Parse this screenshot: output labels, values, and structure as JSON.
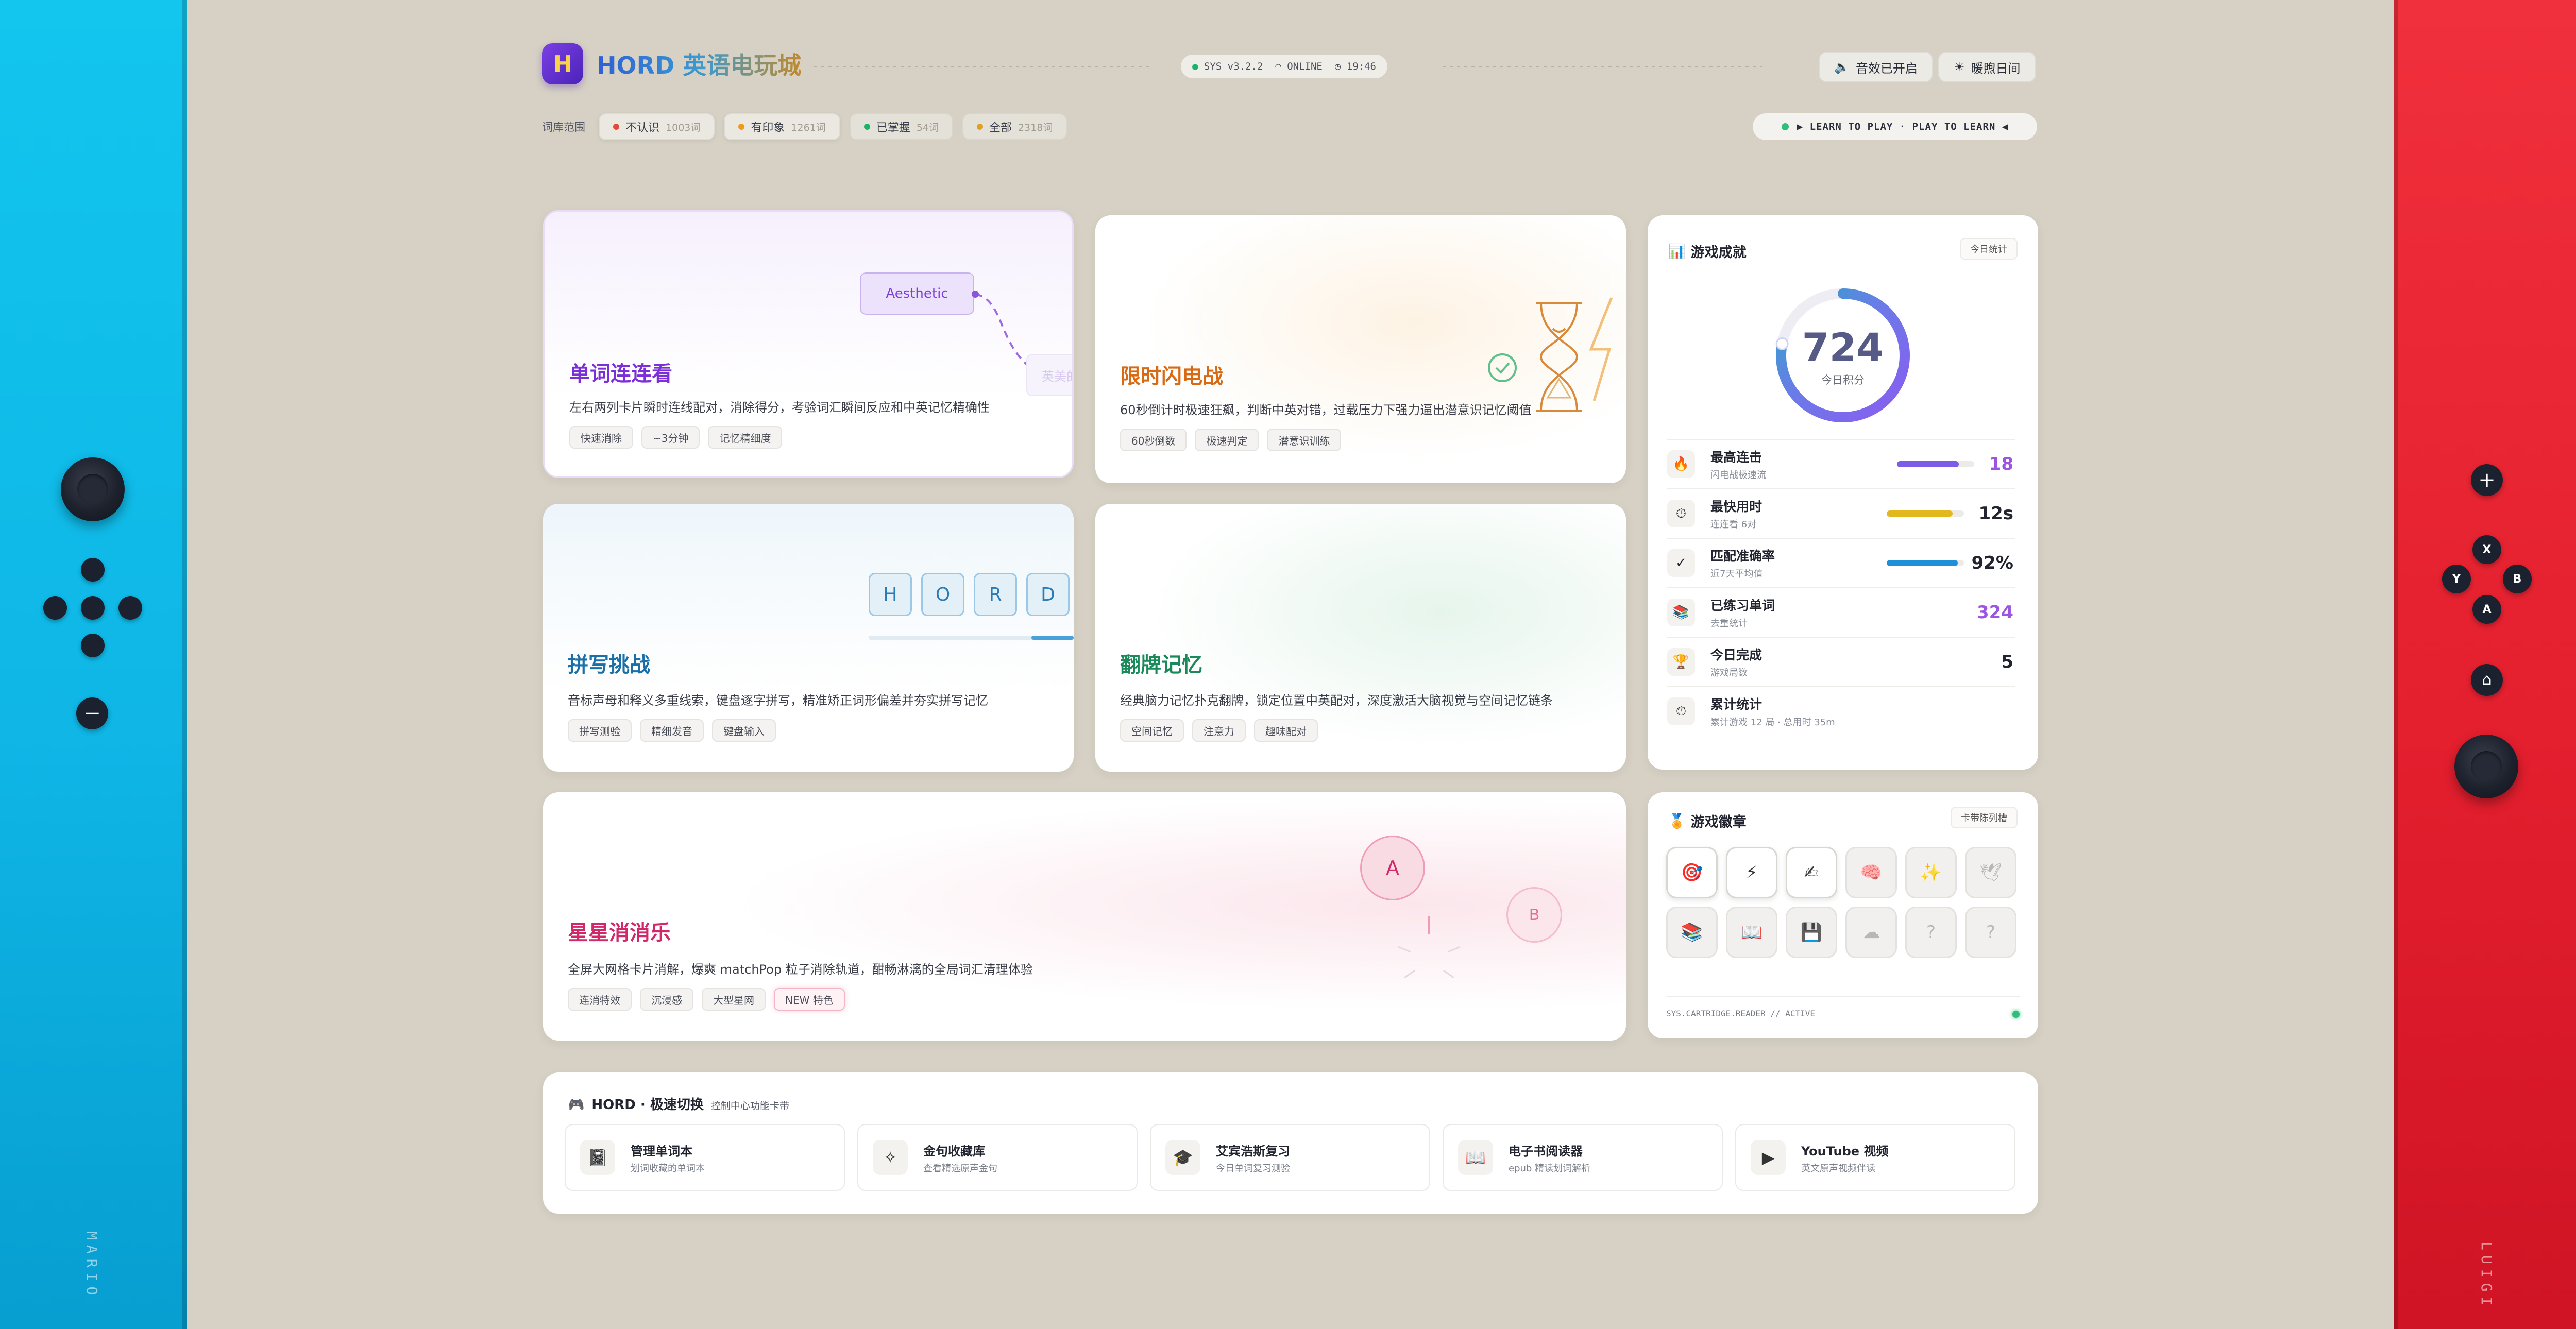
{
  "header": {
    "logo_glyph": "H",
    "title": "HORD 英语电玩城",
    "sys_version": "SYS v3.2.2",
    "network": "ONLINE",
    "time": "19:46",
    "sound_btn": "音效已开启",
    "theme_btn": "暖煦日间"
  },
  "filter": {
    "label": "词库范围",
    "chips": [
      {
        "label": "不认识",
        "count": "1003词",
        "color": "#e5483b"
      },
      {
        "label": "有印象",
        "count": "1261词",
        "color": "#f09a1a"
      },
      {
        "label": "已掌握",
        "count": "54词",
        "color": "#1bb36b"
      },
      {
        "label": "全部",
        "count": "2318词",
        "color": "#e0a020"
      }
    ]
  },
  "motto": "▶ LEARN TO PLAY · PLAY TO LEARN ◀",
  "games": [
    {
      "title": "单词连连看",
      "desc": "左右两列卡片瞬时连线配对，消除得分，考验词汇瞬间反应和中英记忆精确性",
      "tags": [
        "快速消除",
        "~3分钟",
        "记忆精细度"
      ],
      "color": "#7a2fd8",
      "deco": "Aesthetic",
      "deco2": "英美的"
    },
    {
      "title": "限时闪电战",
      "desc": "60秒倒计时极速狂飙，判断中英对错，过载压力下强力逼出潜意识记忆阈值",
      "tags": [
        "60秒倒数",
        "极速判定",
        "潜意识训练"
      ],
      "color": "#d86a14"
    },
    {
      "title": "拼写挑战",
      "desc": "音标声母和释义多重线索，键盘逐字拼写，精准矫正词形偏差并夯实拼写记忆",
      "tags": [
        "拼写测验",
        "精细发音",
        "键盘输入"
      ],
      "color": "#1a6fa8",
      "letters": [
        "H",
        "O",
        "R",
        "D"
      ]
    },
    {
      "title": "翻牌记忆",
      "desc": "经典脑力记忆扑克翻牌，锁定位置中英配对，深度激活大脑视觉与空间记忆链条",
      "tags": [
        "空间记忆",
        "注意力",
        "趣味配对"
      ],
      "color": "#1a8a5a"
    },
    {
      "title": "星星消消乐",
      "desc": "全屏大网格卡片消解，爆爽 matchPop 粒子消除轨道，酣畅淋漓的全局词汇清理体验",
      "tags": [
        "连消特效",
        "沉浸感",
        "大型星网",
        "NEW 特色"
      ],
      "color": "#d1286a",
      "bubble_a": "A",
      "bubble_b": "B"
    }
  ],
  "stats": {
    "title": "游戏成就",
    "badge": "今日统计",
    "score": "724",
    "score_label": "今日积分",
    "score_progress": 0.78,
    "rows": [
      {
        "icon": "🔥",
        "title": "最高连击",
        "sub": "闪电战极速流",
        "value": "18",
        "bar": 0.8,
        "color": "#7b5be8"
      },
      {
        "icon": "⏱",
        "title": "最快用时",
        "sub": "连连看 6对",
        "value": "12s",
        "bar": 0.85,
        "color": "#e3b81f"
      },
      {
        "icon": "✓",
        "title": "匹配准确率",
        "sub": "近7天平均值",
        "value": "92%",
        "bar": 0.92,
        "color": "#1f8fd8"
      },
      {
        "icon": "📚",
        "title": "已练习单词",
        "sub": "去重统计",
        "value": "324",
        "color": "#9b55e0"
      },
      {
        "icon": "🏆",
        "title": "今日完成",
        "sub": "游戏局数",
        "value": "5",
        "color": "#22252f"
      },
      {
        "icon": "⏱",
        "title": "累计统计",
        "sub": "累计游戏 12 局 · 总用时 35m"
      }
    ]
  },
  "badges": {
    "title": "游戏徽章",
    "btn": "卡带陈列槽",
    "items": [
      "🎯",
      "⚡",
      "✍",
      "🧠",
      "✨",
      "🕊",
      "📚",
      "📖",
      "💾",
      "☁",
      "?",
      "?"
    ],
    "footer": "SYS.CARTRIDGE.READER // ACTIVE"
  },
  "quick": {
    "title": "HORD · 极速切换",
    "subtitle": "控制中心功能卡带",
    "items": [
      {
        "icon": "📓",
        "title": "管理单词本",
        "sub": "划词收藏的单词本"
      },
      {
        "icon": "✧",
        "title": "金句收藏库",
        "sub": "查看精选原声金句"
      },
      {
        "icon": "🎓",
        "title": "艾宾浩斯复习",
        "sub": "今日单词复习测验"
      },
      {
        "icon": "📖",
        "title": "电子书阅读器",
        "sub": "epub 精读划词解析"
      },
      {
        "icon": "▶",
        "title": "YouTube 视频",
        "sub": "英文原声视频伴读"
      }
    ]
  },
  "joycons": {
    "left_label": "MARIO",
    "right_label": "LUIGI",
    "btn_x": "X",
    "btn_y": "Y",
    "btn_a": "A",
    "btn_b": "B",
    "plus": "+",
    "minus": "−",
    "home": "⌂"
  }
}
